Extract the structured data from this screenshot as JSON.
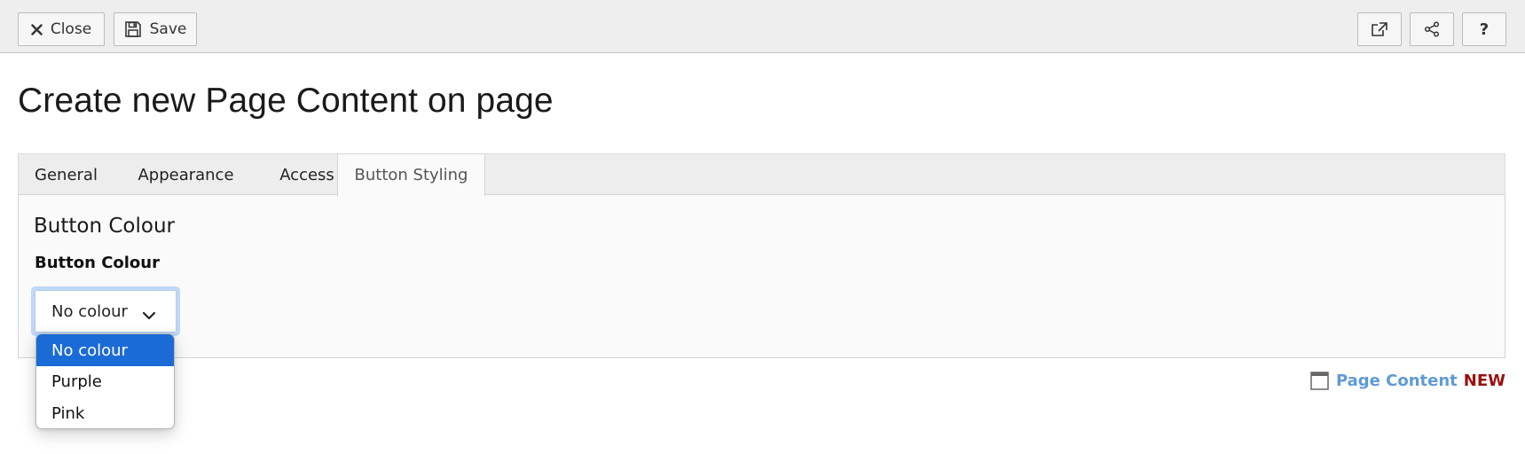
{
  "toolbar": {
    "close_label": "Close",
    "save_label": "Save",
    "icons": {
      "close": "close-x-icon",
      "save": "floppy-disk-icon",
      "open_new": "external-link-icon",
      "share": "share-icon",
      "help": "question-mark-icon"
    },
    "help_glyph": "?"
  },
  "page": {
    "title": "Create new Page Content on page"
  },
  "tabs": [
    {
      "label": "General",
      "active": false
    },
    {
      "label": "Appearance",
      "active": false
    },
    {
      "label": "Access",
      "active": false
    },
    {
      "label": "Button Styling",
      "active": true
    }
  ],
  "panel": {
    "section_heading": "Button Colour",
    "field_label": "Button Colour",
    "select": {
      "value": "No colour",
      "options": [
        "No colour",
        "Purple",
        "Pink"
      ]
    }
  },
  "record_info": {
    "type_label": "Page Content",
    "state_label": "NEW",
    "icon": "page-window-icon"
  },
  "colors": {
    "selected_option": "#1a6bd6",
    "record_type": "#5e9bd5",
    "record_state": "#9b1010",
    "toolbar_bg": "#eeeeee"
  }
}
